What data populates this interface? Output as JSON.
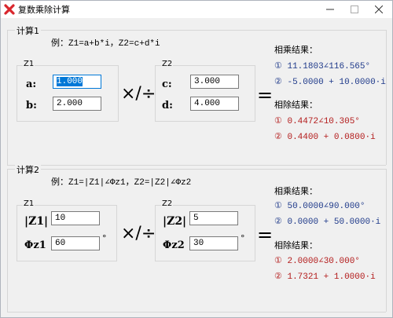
{
  "window": {
    "title": "复数乘除计算"
  },
  "section1": {
    "title": "计算1",
    "example": "例：Z1=a+b*i，Z2=c+d*i",
    "z1": {
      "label": "Z1",
      "a_label": "a:",
      "a_value": "1.000",
      "b_label": "b:",
      "b_value": "2.000"
    },
    "z2": {
      "label": "Z2",
      "c_label": "c:",
      "c_value": "3.000",
      "d_label": "d:",
      "d_value": "4.000"
    },
    "operator": "×/÷",
    "equals": "=",
    "mul_title": "相乘结果：",
    "mul_results": [
      "① 11.1803∠116.565°",
      "② -5.0000 + 10.0000·i"
    ],
    "div_title": "相除结果：",
    "div_results": [
      "① 0.4472∠10.305°",
      "② 0.4400 + 0.0800·i"
    ]
  },
  "section2": {
    "title": "计算2",
    "example": "例：Z1=|Z1|∠Φz1，Z2=|Z2|∠Φz2",
    "z1": {
      "label": "Z1",
      "mod_label": "|Z1|",
      "mod_value": "10",
      "ang_label": "Φz1",
      "ang_value": "60",
      "unit": "°"
    },
    "z2": {
      "label": "Z2",
      "mod_label": "|Z2|",
      "mod_value": "5",
      "ang_label": "Φz2",
      "ang_value": "30",
      "unit": "°"
    },
    "operator": "×/÷",
    "equals": "=",
    "mul_title": "相乘结果：",
    "mul_results": [
      "① 50.0000∠90.000°",
      "② 0.0000 + 50.0000·i"
    ],
    "div_title": "相除结果：",
    "div_results": [
      "① 2.0000∠30.000°",
      "② 1.7321 + 1.0000·i"
    ]
  },
  "colors": {
    "mul": "#1f3a8a",
    "div": "#b31b1b",
    "accent": "#0078d7"
  },
  "icons": {
    "app": "red-x-icon",
    "minimize": "minimize-icon",
    "maximize": "maximize-icon",
    "close": "close-icon"
  }
}
